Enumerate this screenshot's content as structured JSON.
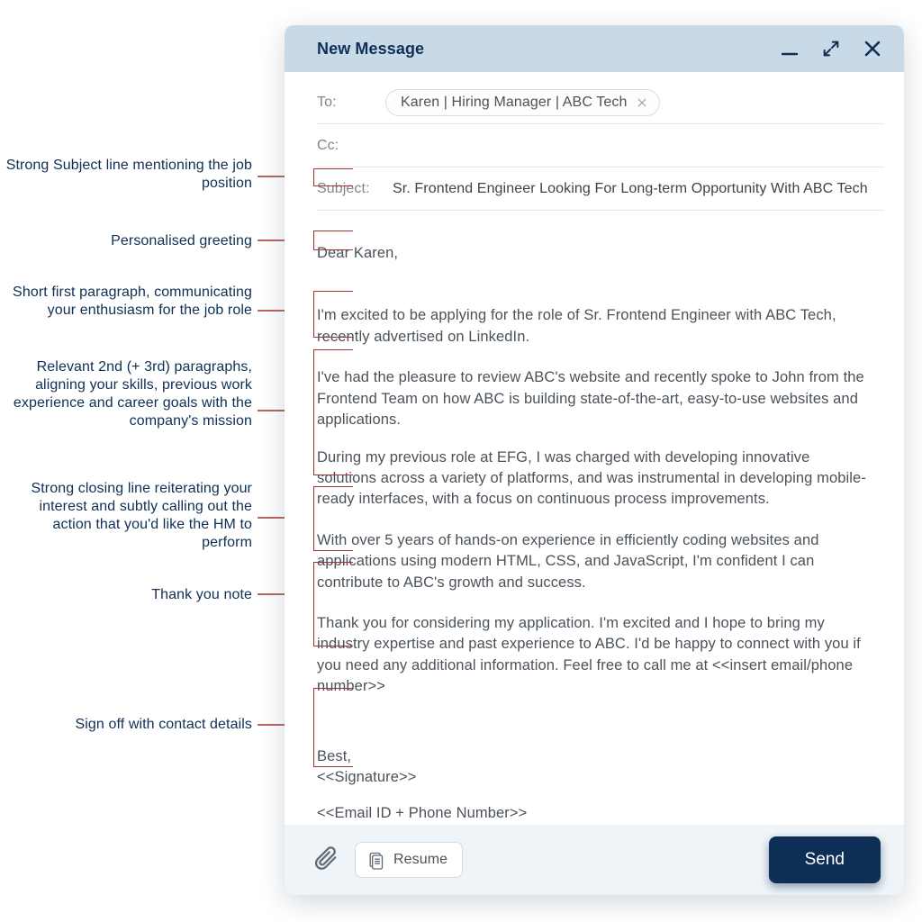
{
  "window": {
    "title": "New Message"
  },
  "fields": {
    "to_label": "To:",
    "cc_label": "Cc:",
    "subject_label": "Subject:",
    "recipient_chip": "Karen | Hiring Manager | ABC Tech",
    "subject_text": "Sr. Frontend Engineer Looking For Long-term Opportunity With ABC Tech"
  },
  "body": {
    "greeting": "Dear Karen,",
    "p1": "I'm excited to be applying for the role of Sr. Frontend Engineer with ABC Tech, recently advertised on LinkedIn.",
    "p2": "I've had the pleasure to review ABC's website and recently spoke to John from the Frontend Team on how ABC is building state-of-the-art, easy-to-use websites and applications.",
    "p3": "During my previous role at EFG, I was charged with developing innovative solutions across a variety of platforms, and was instrumental in developing mobile-ready interfaces, with a focus on continuous process improvements.",
    "p4": "With over 5 years of hands-on experience in efficiently coding websites and applications using modern HTML, CSS, and JavaScript, I'm confident I can contribute to ABC's growth and success.",
    "p5": "Thank you for considering my application. I'm excited and I hope to bring my industry expertise and past experience to ABC. I'd be happy to connect with you if you need any additional information. Feel free to call me at <<insert email/phone number>>",
    "signoff1": "Best,",
    "signoff2": "<<Signature>>",
    "signoff3": "<<Email ID + Phone Number>>"
  },
  "bottombar": {
    "attachment_label": "Resume",
    "send_label": "Send"
  },
  "annotations": {
    "a1": "Strong Subject line mentioning the job position",
    "a2": "Personalised greeting",
    "a3": "Short first paragraph, communicating your enthusiasm for the job role",
    "a4": "Relevant 2nd (+ 3rd) paragraphs, aligning your skills, previous work experience and career goals with the company's mission",
    "a5": "Strong closing line reiterating your interest and subtly calling out the action that you'd like the HM to perform",
    "a6": "Thank you note",
    "a7": "Sign off with contact details"
  }
}
